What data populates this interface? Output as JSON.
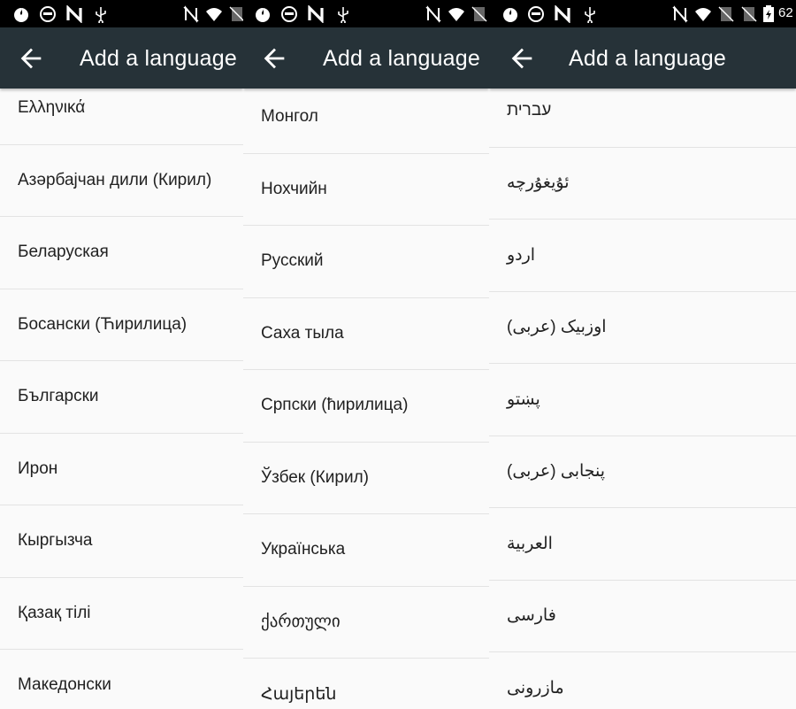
{
  "app": {
    "title": "Add a language",
    "battery_text": "62",
    "colors": {
      "toolbar": "#263238",
      "status_bar": "#000000",
      "background": "#fafafa",
      "divider": "#e3e3e3",
      "text": "#212121"
    }
  },
  "status_icons": [
    "fire-icon",
    "face-icon",
    "n-icon",
    "usb-icon",
    "nfc-icon",
    "wifi-icon",
    "no-sim-icon",
    "battery-charging-icon"
  ],
  "panels": [
    {
      "items": [
        "Ελληνικά",
        "Азәрбајчан дили (Кирил)",
        "Беларуская",
        "Босански (Ћирилица)",
        "Български",
        "Ирон",
        "Кыргызча",
        "Қазақ тілі",
        "Македонски"
      ]
    },
    {
      "items": [
        "Монгол",
        "Нохчийн",
        "Русский",
        "Саха тыла",
        "Српски (ћирилица)",
        "Ўзбек (Кирил)",
        "Українська",
        "ქართული",
        "Հայերեն"
      ]
    },
    {
      "items": [
        "עברית",
        "ئۇيغۇرچە",
        "اردو",
        "اوزبیک (عربی)",
        "پښتو",
        "پنجابی (عربی)",
        "العربية",
        "فارسی",
        "مازرونی"
      ]
    }
  ]
}
